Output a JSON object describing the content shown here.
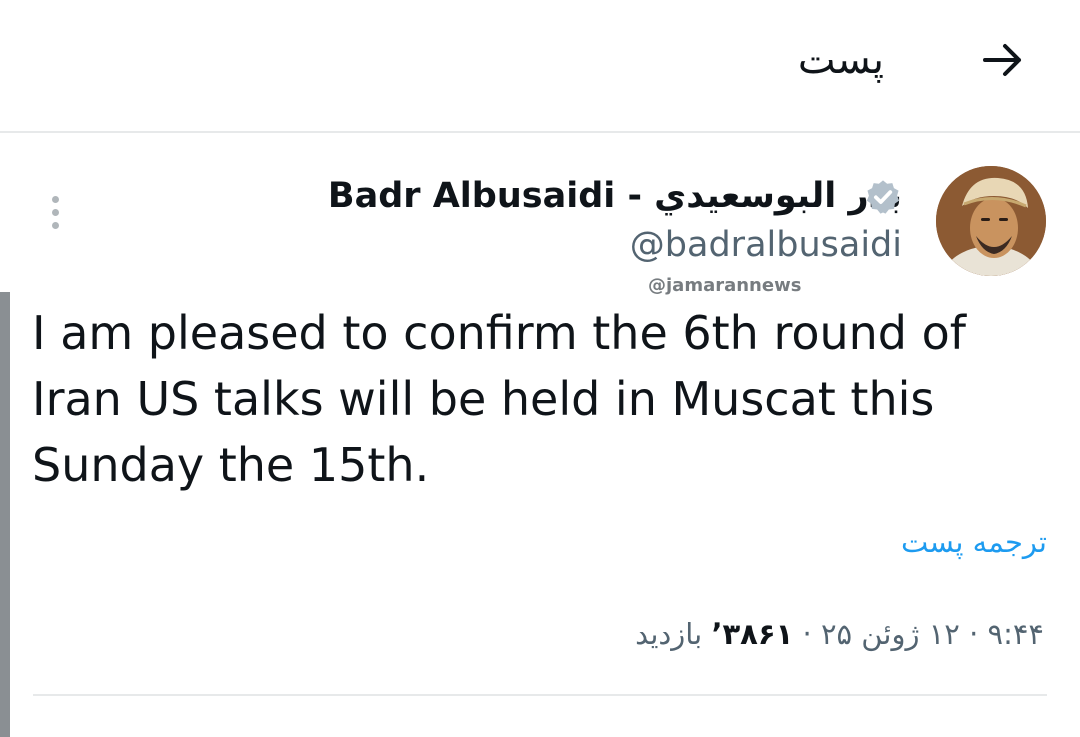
{
  "header": {
    "title": "پست",
    "back_icon": "arrow-right-icon"
  },
  "tweet": {
    "author": {
      "display_name": "Badr Albusaidi - بدر البوسعيدي",
      "handle": "@badralbusaidi",
      "verified": true,
      "verified_color": "#1d9bf0"
    },
    "watermark": "@jamarannews",
    "text": "I am pleased to confirm the 6th round of Iran US talks will be held in Muscat this Sunday the 15th.",
    "translate_label": "ترجمه پست",
    "meta": {
      "time": "۹:۴۴",
      "date": "۱۲ ژوئن ۲۵",
      "views_count": "۳۸۶۱’",
      "views_label": "بازدید",
      "separator": "·"
    }
  },
  "colors": {
    "text_primary": "#0f1419",
    "text_secondary": "#536471",
    "link": "#1d9bf0",
    "divider": "#e7e9ea"
  }
}
